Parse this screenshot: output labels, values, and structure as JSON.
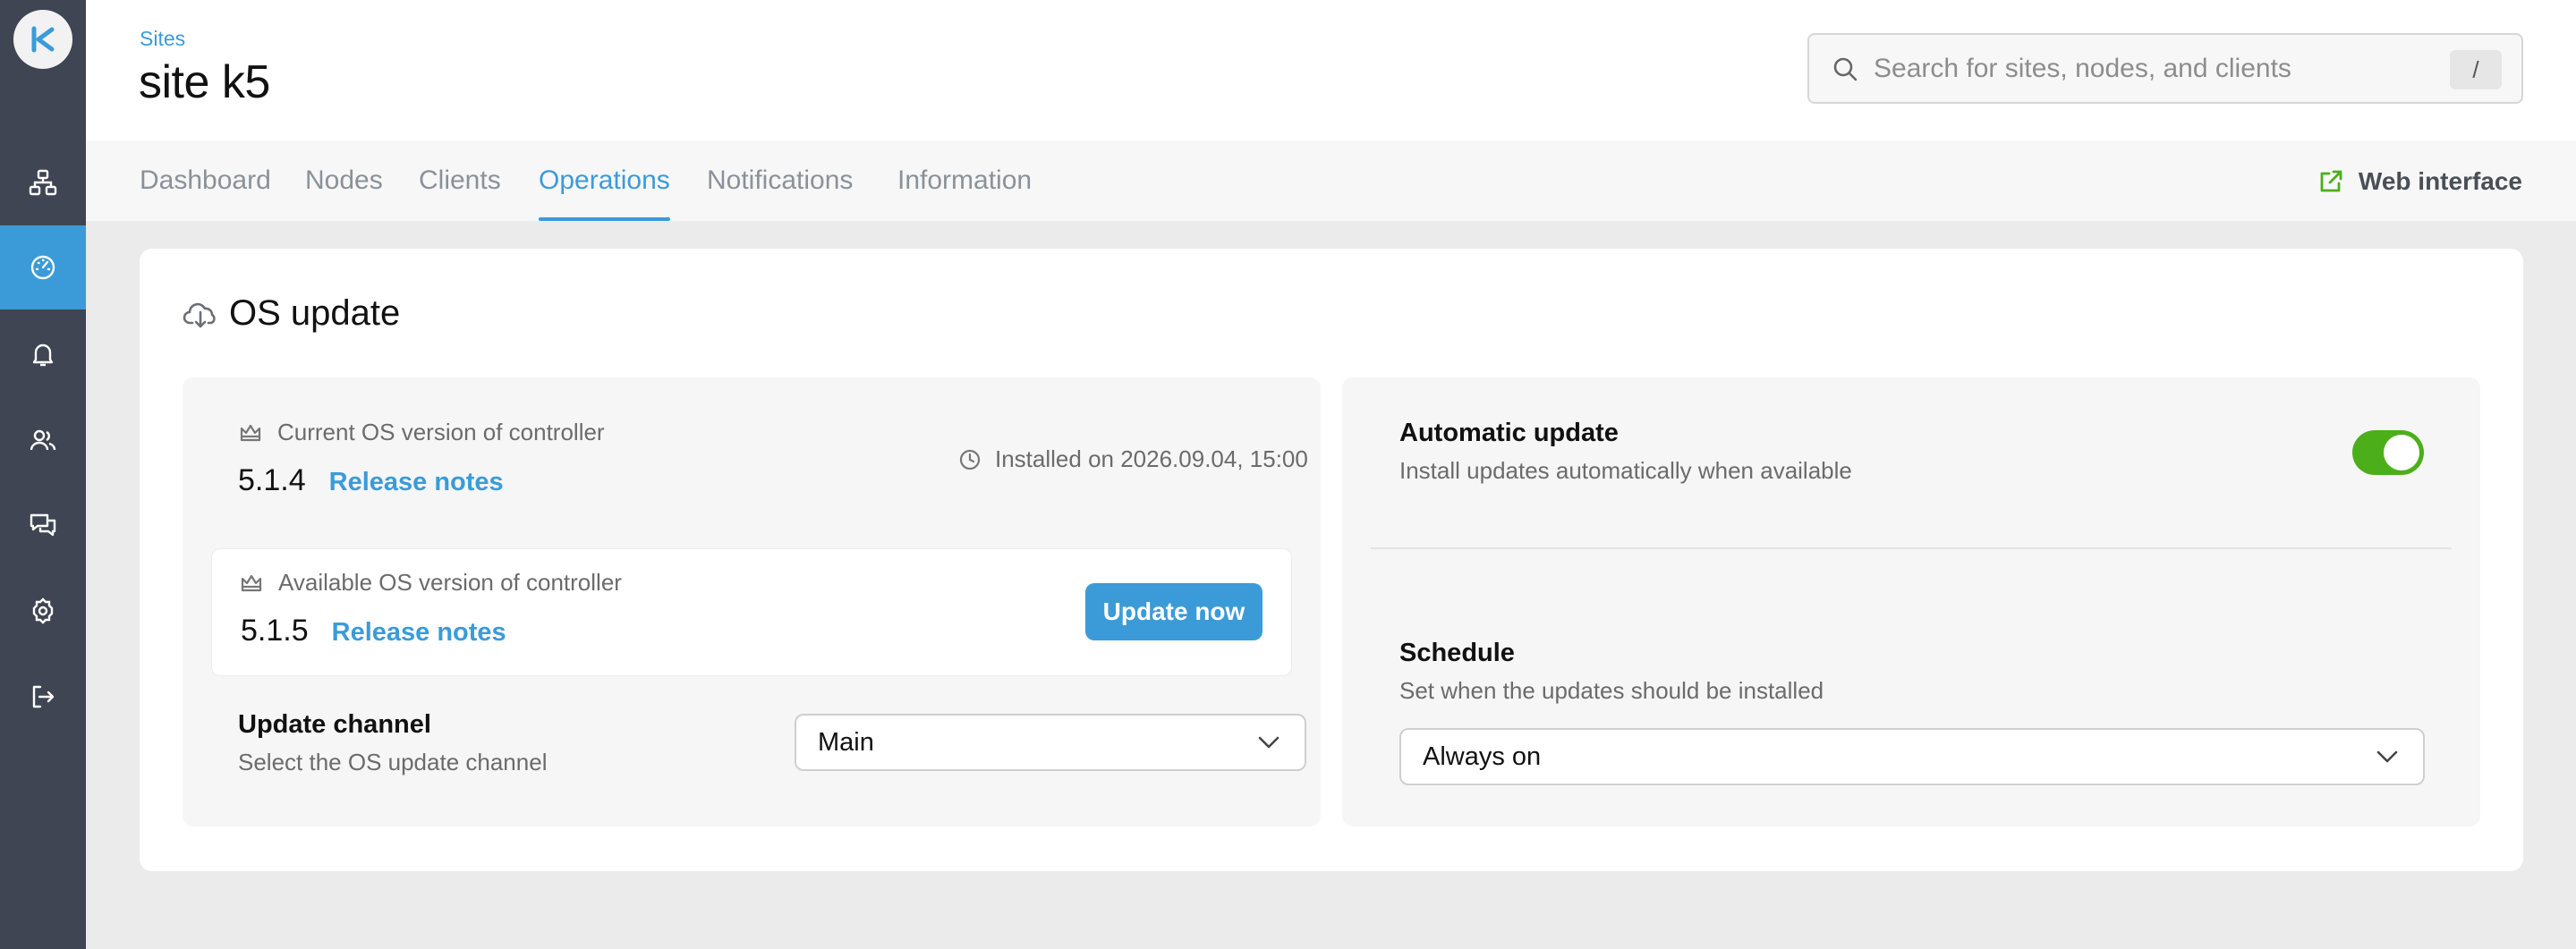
{
  "sidebar": {
    "logo": "K",
    "items": [
      {
        "name": "sites",
        "icon": "network-icon"
      },
      {
        "name": "dashboard",
        "icon": "gauge-icon",
        "active": true
      },
      {
        "name": "notifications",
        "icon": "bell-icon"
      },
      {
        "name": "users",
        "icon": "users-icon"
      },
      {
        "name": "messages",
        "icon": "chat-icon"
      },
      {
        "name": "settings",
        "icon": "gear-icon"
      },
      {
        "name": "logout",
        "icon": "logout-icon"
      }
    ]
  },
  "header": {
    "breadcrumb": "Sites",
    "title": "site k5",
    "search_placeholder": "Search for sites, nodes, and clients",
    "search_shortcut": "/"
  },
  "tabs": {
    "items": [
      "Dashboard",
      "Nodes",
      "Clients",
      "Operations",
      "Notifications",
      "Information"
    ],
    "active": "Operations",
    "web_interface": "Web interface"
  },
  "os_update": {
    "title": "OS update",
    "current": {
      "label": "Current OS version of controller",
      "version": "5.1.4",
      "release_notes": "Release notes",
      "installed": "Installed on 2026.09.04, 15:00"
    },
    "available": {
      "label": "Available OS version of controller",
      "version": "5.1.5",
      "release_notes": "Release notes",
      "button": "Update now"
    },
    "channel": {
      "title": "Update channel",
      "subtitle": "Select the OS update channel",
      "value": "Main"
    },
    "automatic": {
      "title": "Automatic update",
      "subtitle": "Install updates automatically when available",
      "enabled": true
    },
    "schedule": {
      "title": "Schedule",
      "subtitle": "Set when the updates should be installed",
      "value": "Always on"
    }
  },
  "colors": {
    "accent": "#3b9bd8",
    "sidebar": "#3f4552",
    "toggle_on": "#4caf1a"
  }
}
